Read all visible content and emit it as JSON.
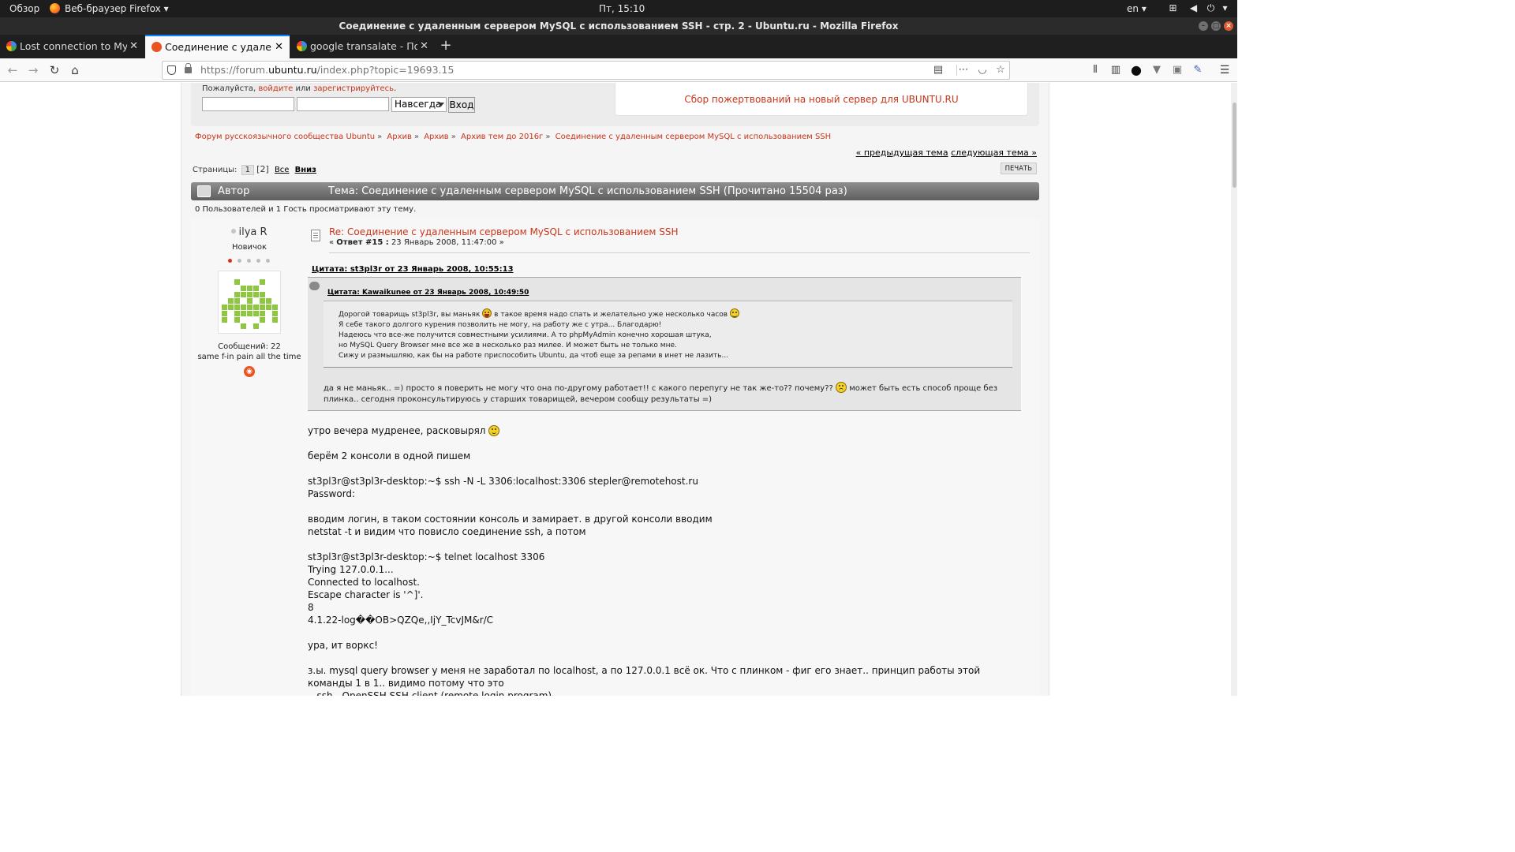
{
  "system": {
    "overview": "Обзор",
    "app_name": "Веб-браузер Firefox",
    "clock": "Пт, 15:10",
    "lang": "en"
  },
  "window": {
    "title": "Соединение с удаленным сервером MySQL с использованием SSH - стр. 2 - Ubuntu.ru - Mozilla Firefox"
  },
  "tabs": [
    {
      "label": "Lost connection to MySQL",
      "active": false,
      "favicon": "google-icon"
    },
    {
      "label": "Соединение с удаленным сервером",
      "active": true,
      "favicon": "ubuntu-icon"
    },
    {
      "label": "google transalate - Поиск в Google",
      "active": false,
      "favicon": "google-icon"
    }
  ],
  "urlbar": {
    "prefix": "https://forum.",
    "domain": "ubuntu.ru",
    "path": "/index.php?topic=19693.15"
  },
  "login": {
    "hint_prefix": "Пожалуйста, ",
    "login_link": "войдите",
    "hint_mid": " или ",
    "register_link": "зарегистрируйтесь",
    "hint_suffix": ".",
    "duration": "Навсегда",
    "submit": "Вход"
  },
  "donate": "Сбор пожертвований на новый сервер для UBUNTU.RU",
  "breadcrumb": [
    "Форум русскоязычного сообщества Ubuntu",
    "Архив",
    "Архив",
    "Архив тем до 2016г",
    "Соединение с удаленным сервером MySQL с использованием SSH"
  ],
  "prevnext": {
    "prev": "« предыдущая тема",
    "next": "следующая тема »"
  },
  "pages": {
    "label": "Страницы:",
    "page1": "1",
    "current": "[2]",
    "all": "Все",
    "down": "Вниз",
    "print": "ПЕЧАТЬ"
  },
  "topic_header": {
    "author": "Автор",
    "topic": "Тема: Соединение с удаленным сервером MySQL с использованием SSH  (Прочитано 15504 раз)"
  },
  "viewers": "0 Пользователей и 1 Гость просматривают эту тему.",
  "post": {
    "author": "ilya R",
    "rank": "Новичок",
    "stars_filled": 1,
    "stars_total": 5,
    "messages": "Сообщений: 22",
    "signature": "same f-in pain all the time",
    "subject": "Re: Соединение с удаленным сервером MySQL с использованием SSH",
    "meta_prefix": "« ",
    "reply_no": "Ответ #15 :",
    "meta_date": " 23 Январь 2008, 11:47:00 »",
    "quote_outer_head": "Цитата: st3pl3r от 23 Январь 2008, 10:55:13",
    "quote_inner_head": "Цитата: Kawaikunee от 23 Январь 2008, 10:49:50",
    "quote_inner_lines": [
      "Дорогой товарищь st3pl3r, вы маньяк",
      "в такое время надо спать и желательно уже несколько часов",
      "Я себе такого долгого курения позволить не могу, на работу же с утра... Благодарю!",
      "Надеюсь что все-же получится совместными усилиями. А то phpMyAdmin конечно хорошая штука,",
      "но MySQL Query Browser мне все же в несколько раз милее. И может быть не только мне.",
      "Сижу и размышляю, как бы на работе приспособить Ubuntu, да чтоб еще за репами в инет не лазить..."
    ],
    "quote_outer_text_a": "да я не маньяк.. =) просто я поверить не могу что она по-другому работает!! с какого перепугу не так же-то?? почему??",
    "quote_outer_text_b": "может быть есть способ проще без плинка.. сегодня проконсультируюсь у старших товарищей, вечером сообщу результаты =)",
    "body_lines": [
      "утро вечера мудренее, расковырял",
      "",
      "берём 2 консоли в одной пишем",
      "",
      "st3pl3r@st3pl3r-desktop:~$ ssh -N -L 3306:localhost:3306 stepler@remotehost.ru",
      "Password:",
      "",
      "вводим логин, в таком состоянии консоль и замирает. в другой консоли вводим",
      "netstat -t и видим что повисло соединение ssh, а потом",
      "",
      "st3pl3r@st3pl3r-desktop:~$ telnet localhost 3306",
      "Trying 127.0.0.1...",
      "Connected to localhost.",
      "Escape character is '^]'.",
      "8",
      "4.1.22-log��OB>QZQe,,IjY_TcvJM&r/C",
      "",
      "ура, ит воркс!",
      "",
      "з.ы. mysql query browser у меня не заработал по localhost, а по 127.0.0.1 всё ок. Что с плинком - фиг его знает.. принцип работы этой команды 1 в 1.. видимо потому что это",
      "...ssh - OpenSSH SSH client (remote login program)"
    ]
  }
}
